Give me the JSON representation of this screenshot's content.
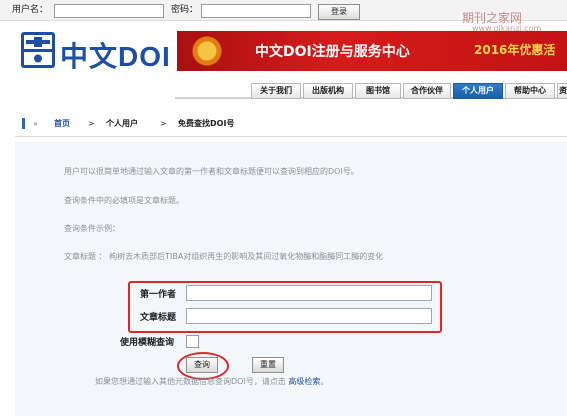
{
  "login": {
    "username_label": "用户名：",
    "password_label": "密码：",
    "username_value": "",
    "password_value": "",
    "login_button": "登录"
  },
  "watermark": {
    "title": "期刊之家网",
    "url": "www.qikanzj.com"
  },
  "header": {
    "logo_text": "中文DOI",
    "banner_main": "中文DOI注册与服务中心",
    "banner_promo": "2016年优惠活"
  },
  "nav": {
    "items": [
      "关于我们",
      "出版机构",
      "图书馆",
      "合作伙伴",
      "个人用户",
      "帮助中心",
      "资"
    ],
    "active": "个人用户"
  },
  "breadcrumb": {
    "prefix": "»",
    "home": "首页",
    "sep1": ">",
    "level1": "个人用户",
    "sep2": ">",
    "current": "免费查找DOI号"
  },
  "content": {
    "intro": "用户可以很简单地通过输入文章的第一作者和文章标题便可以查询到相应的DOI号。",
    "required": "查询条件中的必填项是文章标题。",
    "example_heading": "查询条件示例：",
    "example_line": "文章标题 ： 枸树去木质部后TIBA对组织再生的影响及其间过氧化物酶和酯酶同工酶的变化"
  },
  "form": {
    "author_label": "第一作者",
    "title_label": "文章标题",
    "author_value": "",
    "title_value": "",
    "fuzzy_label": "使用模糊查询",
    "query_button": "查询",
    "reset_button": "重置",
    "footer_text": "如果您想通过输入其他元数据信息查询DOI号，请点击",
    "advanced_link": "高级检索",
    "footer_end": "。"
  },
  "colors": {
    "accent_blue": "#1f4fa3",
    "banner_red": "#c41212",
    "highlight_red": "#d9292b"
  }
}
